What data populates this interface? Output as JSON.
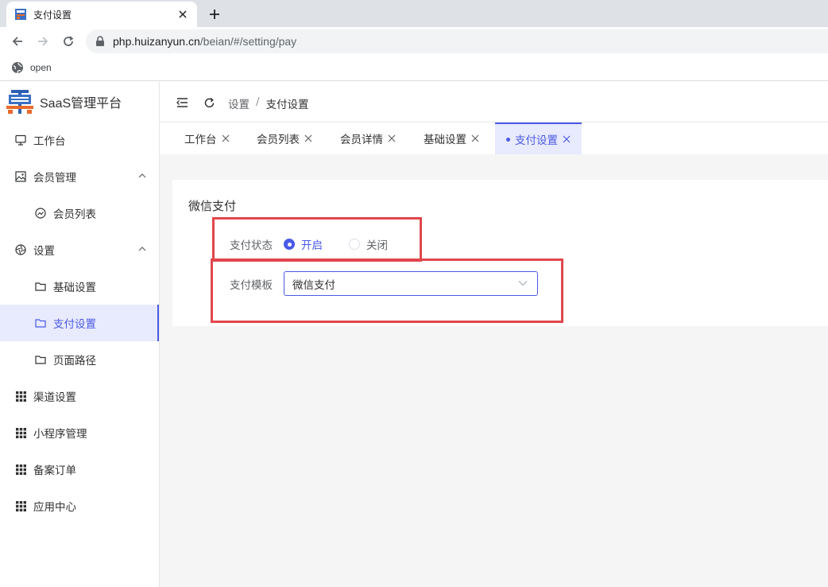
{
  "browser": {
    "tab_title": "支付设置",
    "url_host": "php.huizanyun.cn",
    "url_path": "/beian/#/setting/pay",
    "bookmark_label": "open"
  },
  "app": {
    "brand_name": "SaaS管理平台"
  },
  "sidebar": {
    "items": [
      {
        "label": "工作台",
        "icon": "monitor-icon"
      },
      {
        "label": "会员管理",
        "icon": "picture-icon"
      },
      {
        "label": "会员列表",
        "icon": "chart-circle-icon"
      },
      {
        "label": "设置",
        "icon": "aperture-icon"
      },
      {
        "label": "基础设置",
        "icon": "folder-icon"
      },
      {
        "label": "支付设置",
        "icon": "folder-icon"
      },
      {
        "label": "页面路径",
        "icon": "folder-icon"
      },
      {
        "label": "渠道设置",
        "icon": "grid-icon"
      },
      {
        "label": "小程序管理",
        "icon": "grid-icon"
      },
      {
        "label": "备案订单",
        "icon": "grid-icon"
      },
      {
        "label": "应用中心",
        "icon": "grid-icon"
      }
    ]
  },
  "header": {
    "breadcrumb": [
      "设置",
      "支付设置"
    ],
    "separator": "/"
  },
  "tags": [
    {
      "label": "工作台"
    },
    {
      "label": "会员列表"
    },
    {
      "label": "会员详情"
    },
    {
      "label": "基础设置"
    },
    {
      "label": "支付设置"
    }
  ],
  "form": {
    "title": "微信支付",
    "status_label": "支付状态",
    "status_on": "开启",
    "status_off": "关闭",
    "status_value": "开启",
    "template_label": "支付模板",
    "template_value": "微信支付"
  },
  "colors": {
    "accent": "#4a5ae8",
    "annotation": "#e0474c"
  }
}
